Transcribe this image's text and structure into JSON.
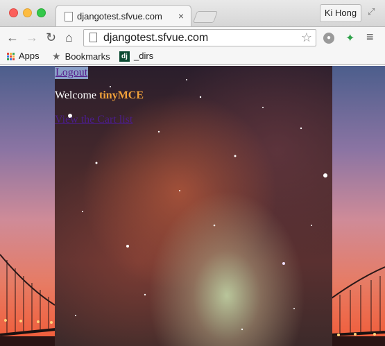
{
  "browser": {
    "tab_title": "djangotest.sfvue.com",
    "tab_close": "×",
    "profile_name": "Ki Hong",
    "url": "djangotest.sfvue.com",
    "nav": {
      "back": "←",
      "forward": "→",
      "reload": "↻",
      "home": "⌂"
    },
    "bookmark_star": "☆",
    "menu": "≡",
    "bookmarks": {
      "apps_label": "Apps",
      "bookmarks_label": "Bookmarks",
      "dirs_label": "_dirs",
      "dirs_icon_text": "dj"
    },
    "colors": {
      "apps_grid": [
        "#e24a3c",
        "#f1b43b",
        "#3aa655",
        "#3a7ee2",
        "#e24a3c",
        "#f1b43b",
        "#3aa655",
        "#3a7ee2",
        "#e24a3c"
      ]
    }
  },
  "page": {
    "logout_label": "Logout",
    "welcome_prefix": "Welcome",
    "welcome_user": "tinyMCE",
    "cart_link": "View the Cart list"
  }
}
